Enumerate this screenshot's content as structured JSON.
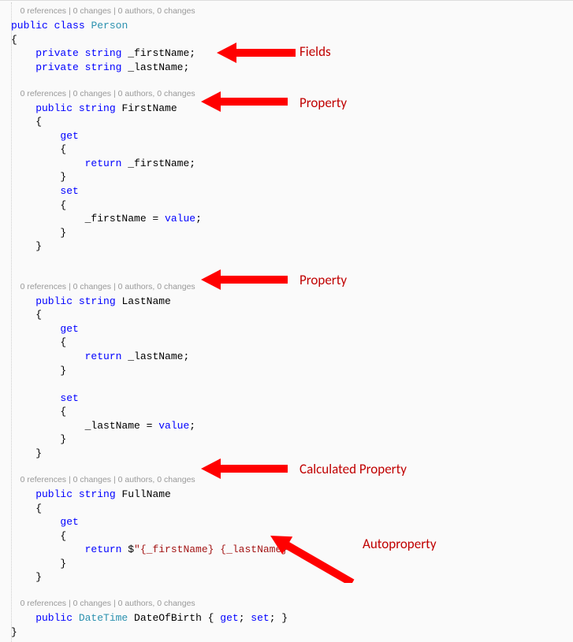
{
  "codelens": "0 references | 0 changes | 0 authors, 0 changes",
  "code": {
    "l1a": "public",
    "l1b": " ",
    "l1c": "class",
    "l1d": " ",
    "l1e": "Person",
    "l2": "{",
    "l3a": "    private",
    "l3b": " ",
    "l3c": "string",
    "l3d": " _firstName;",
    "l4a": "    private",
    "l4b": " ",
    "l4c": "string",
    "l4d": " _lastName;",
    "l6a": "    public",
    "l6b": " ",
    "l6c": "string",
    "l6d": " FirstName",
    "l7": "    {",
    "l8a": "        get",
    "l9": "        {",
    "l10a": "            return",
    "l10b": " _firstName;",
    "l11": "        }",
    "l12a": "        set",
    "l13": "        {",
    "l14a": "            _firstName = ",
    "l14b": "value",
    "l14c": ";",
    "l15": "        }",
    "l16": "    }",
    "l18a": "    public",
    "l18b": " ",
    "l18c": "string",
    "l18d": " LastName",
    "l19": "    {",
    "l20a": "        get",
    "l21": "        {",
    "l22a": "            return",
    "l22b": " _lastName;",
    "l23": "        }",
    "l25a": "        set",
    "l26": "        {",
    "l27a": "            _lastName = ",
    "l27b": "value",
    "l27c": ";",
    "l28": "        }",
    "l29": "    }",
    "l31a": "    public",
    "l31b": " ",
    "l31c": "string",
    "l31d": " FullName",
    "l32": "    {",
    "l33a": "        get",
    "l34": "        {",
    "l35a": "            return",
    "l35b": " $",
    "l35c": "\"{_firstName} {_lastName}\"",
    "l35d": ";",
    "l36": "        }",
    "l37": "    }",
    "l40a": "    public",
    "l40b": " ",
    "l40c": "DateTime",
    "l40d": " DateOfBirth { ",
    "l40e": "get",
    "l40f": "; ",
    "l40g": "set",
    "l40h": "; }",
    "l41": "}"
  },
  "annotations": {
    "fields": "Fields",
    "property1": "Property",
    "property2": "Property",
    "calcprop": "Calculated Property",
    "autoprop": "Autoproperty"
  }
}
